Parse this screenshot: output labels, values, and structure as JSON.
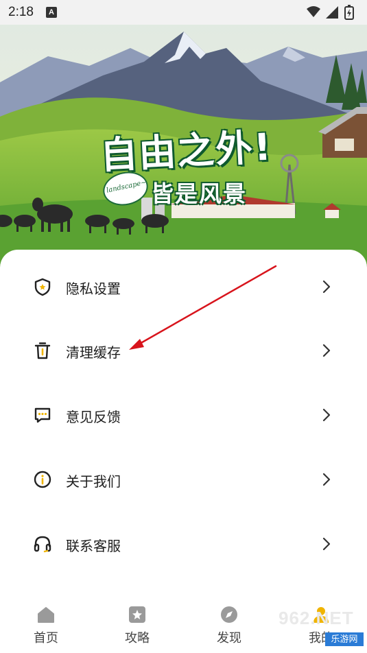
{
  "status_bar": {
    "time": "2:18",
    "notification_glyph": "A"
  },
  "hero": {
    "title": "自由之外!",
    "subtitle": "皆是风景",
    "badge_text": "landscape~"
  },
  "menu": {
    "items": [
      {
        "label": "隐私设置",
        "icon": "shield-icon"
      },
      {
        "label": "清理缓存",
        "icon": "trash-icon"
      },
      {
        "label": "意见反馈",
        "icon": "message-icon"
      },
      {
        "label": "关于我们",
        "icon": "info-icon"
      },
      {
        "label": "联系客服",
        "icon": "headset-icon"
      }
    ]
  },
  "bottom_nav": {
    "items": [
      {
        "label": "首页",
        "icon": "home-icon"
      },
      {
        "label": "攻略",
        "icon": "guide-icon"
      },
      {
        "label": "发现",
        "icon": "compass-icon"
      },
      {
        "label": "我的",
        "icon": "profile-icon"
      }
    ]
  },
  "watermark": {
    "text": "962.NET",
    "sub": "乐游网"
  },
  "colors": {
    "accent": "#f0b400",
    "annotation_arrow": "#d8141c",
    "text": "#1f1f1f"
  }
}
